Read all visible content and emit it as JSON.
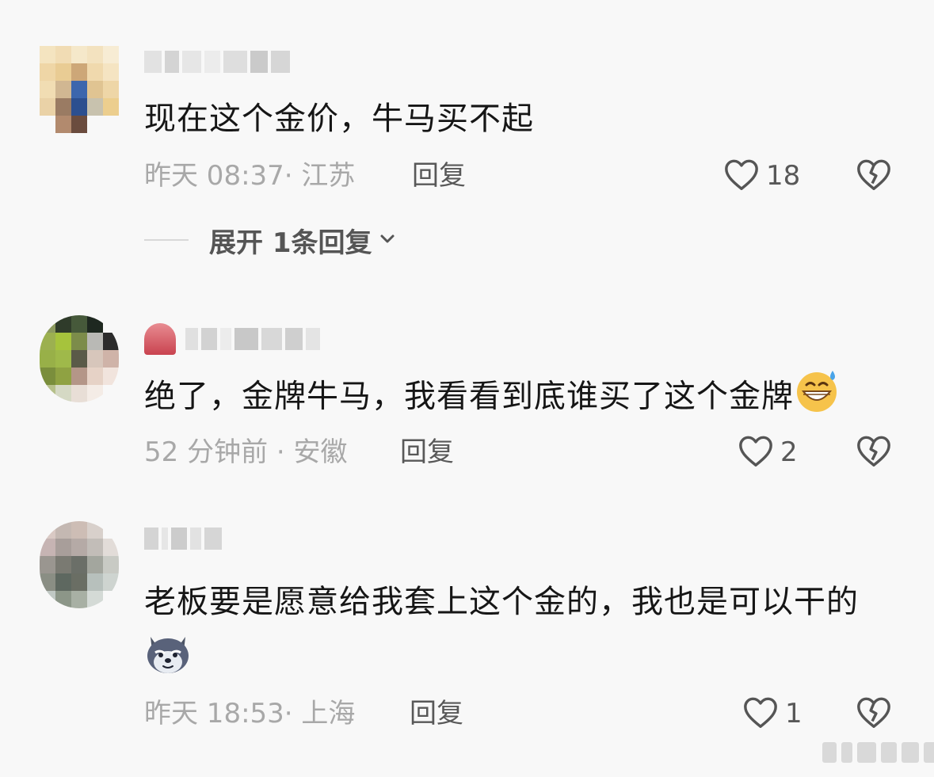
{
  "comments": [
    {
      "text": "现在这个金价，牛马买不起",
      "time_location": "昨天 08:37· 江苏",
      "reply_label": "回复",
      "likes": "18",
      "expand_label": "展开 1条回复"
    },
    {
      "text": "绝了，金牌牛马，我看看到底谁买了这个金牌",
      "emoji": "grin-sweat-emoji",
      "time_location": "52 分钟前 · 安徽",
      "reply_label": "回复",
      "likes": "2"
    },
    {
      "text": "老板要是愿意给我套上这个金的，我也是可以干的",
      "emoji": "wolf-face-emoji",
      "time_location": "昨天 18:53· 上海",
      "reply_label": "回复",
      "likes": "1"
    }
  ],
  "icons": {
    "like": "heart-outline-icon",
    "dislike": "broken-heart-icon",
    "expand": "chevron-down-icon"
  },
  "colors": {
    "background": "#f8f8f8",
    "text": "#161616",
    "meta": "#a8a8a8",
    "action": "#585858"
  }
}
